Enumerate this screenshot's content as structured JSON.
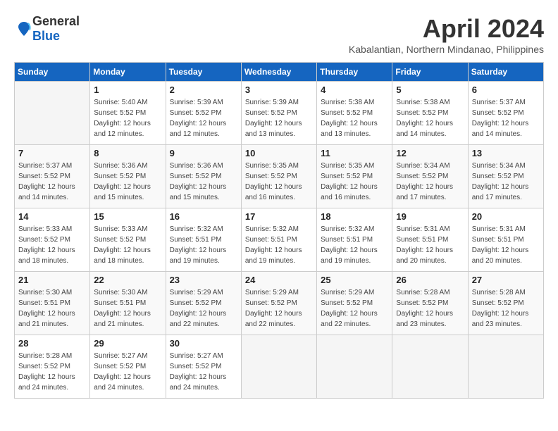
{
  "logo": {
    "general": "General",
    "blue": "Blue"
  },
  "title": "April 2024",
  "location": "Kabalantian, Northern Mindanao, Philippines",
  "weekdays": [
    "Sunday",
    "Monday",
    "Tuesday",
    "Wednesday",
    "Thursday",
    "Friday",
    "Saturday"
  ],
  "weeks": [
    [
      {
        "day": "",
        "sunrise": "",
        "sunset": "",
        "daylight": ""
      },
      {
        "day": "1",
        "sunrise": "Sunrise: 5:40 AM",
        "sunset": "Sunset: 5:52 PM",
        "daylight": "Daylight: 12 hours and 12 minutes."
      },
      {
        "day": "2",
        "sunrise": "Sunrise: 5:39 AM",
        "sunset": "Sunset: 5:52 PM",
        "daylight": "Daylight: 12 hours and 12 minutes."
      },
      {
        "day": "3",
        "sunrise": "Sunrise: 5:39 AM",
        "sunset": "Sunset: 5:52 PM",
        "daylight": "Daylight: 12 hours and 13 minutes."
      },
      {
        "day": "4",
        "sunrise": "Sunrise: 5:38 AM",
        "sunset": "Sunset: 5:52 PM",
        "daylight": "Daylight: 12 hours and 13 minutes."
      },
      {
        "day": "5",
        "sunrise": "Sunrise: 5:38 AM",
        "sunset": "Sunset: 5:52 PM",
        "daylight": "Daylight: 12 hours and 14 minutes."
      },
      {
        "day": "6",
        "sunrise": "Sunrise: 5:37 AM",
        "sunset": "Sunset: 5:52 PM",
        "daylight": "Daylight: 12 hours and 14 minutes."
      }
    ],
    [
      {
        "day": "7",
        "sunrise": "Sunrise: 5:37 AM",
        "sunset": "Sunset: 5:52 PM",
        "daylight": "Daylight: 12 hours and 14 minutes."
      },
      {
        "day": "8",
        "sunrise": "Sunrise: 5:36 AM",
        "sunset": "Sunset: 5:52 PM",
        "daylight": "Daylight: 12 hours and 15 minutes."
      },
      {
        "day": "9",
        "sunrise": "Sunrise: 5:36 AM",
        "sunset": "Sunset: 5:52 PM",
        "daylight": "Daylight: 12 hours and 15 minutes."
      },
      {
        "day": "10",
        "sunrise": "Sunrise: 5:35 AM",
        "sunset": "Sunset: 5:52 PM",
        "daylight": "Daylight: 12 hours and 16 minutes."
      },
      {
        "day": "11",
        "sunrise": "Sunrise: 5:35 AM",
        "sunset": "Sunset: 5:52 PM",
        "daylight": "Daylight: 12 hours and 16 minutes."
      },
      {
        "day": "12",
        "sunrise": "Sunrise: 5:34 AM",
        "sunset": "Sunset: 5:52 PM",
        "daylight": "Daylight: 12 hours and 17 minutes."
      },
      {
        "day": "13",
        "sunrise": "Sunrise: 5:34 AM",
        "sunset": "Sunset: 5:52 PM",
        "daylight": "Daylight: 12 hours and 17 minutes."
      }
    ],
    [
      {
        "day": "14",
        "sunrise": "Sunrise: 5:33 AM",
        "sunset": "Sunset: 5:52 PM",
        "daylight": "Daylight: 12 hours and 18 minutes."
      },
      {
        "day": "15",
        "sunrise": "Sunrise: 5:33 AM",
        "sunset": "Sunset: 5:52 PM",
        "daylight": "Daylight: 12 hours and 18 minutes."
      },
      {
        "day": "16",
        "sunrise": "Sunrise: 5:32 AM",
        "sunset": "Sunset: 5:51 PM",
        "daylight": "Daylight: 12 hours and 19 minutes."
      },
      {
        "day": "17",
        "sunrise": "Sunrise: 5:32 AM",
        "sunset": "Sunset: 5:51 PM",
        "daylight": "Daylight: 12 hours and 19 minutes."
      },
      {
        "day": "18",
        "sunrise": "Sunrise: 5:32 AM",
        "sunset": "Sunset: 5:51 PM",
        "daylight": "Daylight: 12 hours and 19 minutes."
      },
      {
        "day": "19",
        "sunrise": "Sunrise: 5:31 AM",
        "sunset": "Sunset: 5:51 PM",
        "daylight": "Daylight: 12 hours and 20 minutes."
      },
      {
        "day": "20",
        "sunrise": "Sunrise: 5:31 AM",
        "sunset": "Sunset: 5:51 PM",
        "daylight": "Daylight: 12 hours and 20 minutes."
      }
    ],
    [
      {
        "day": "21",
        "sunrise": "Sunrise: 5:30 AM",
        "sunset": "Sunset: 5:51 PM",
        "daylight": "Daylight: 12 hours and 21 minutes."
      },
      {
        "day": "22",
        "sunrise": "Sunrise: 5:30 AM",
        "sunset": "Sunset: 5:51 PM",
        "daylight": "Daylight: 12 hours and 21 minutes."
      },
      {
        "day": "23",
        "sunrise": "Sunrise: 5:29 AM",
        "sunset": "Sunset: 5:52 PM",
        "daylight": "Daylight: 12 hours and 22 minutes."
      },
      {
        "day": "24",
        "sunrise": "Sunrise: 5:29 AM",
        "sunset": "Sunset: 5:52 PM",
        "daylight": "Daylight: 12 hours and 22 minutes."
      },
      {
        "day": "25",
        "sunrise": "Sunrise: 5:29 AM",
        "sunset": "Sunset: 5:52 PM",
        "daylight": "Daylight: 12 hours and 22 minutes."
      },
      {
        "day": "26",
        "sunrise": "Sunrise: 5:28 AM",
        "sunset": "Sunset: 5:52 PM",
        "daylight": "Daylight: 12 hours and 23 minutes."
      },
      {
        "day": "27",
        "sunrise": "Sunrise: 5:28 AM",
        "sunset": "Sunset: 5:52 PM",
        "daylight": "Daylight: 12 hours and 23 minutes."
      }
    ],
    [
      {
        "day": "28",
        "sunrise": "Sunrise: 5:28 AM",
        "sunset": "Sunset: 5:52 PM",
        "daylight": "Daylight: 12 hours and 24 minutes."
      },
      {
        "day": "29",
        "sunrise": "Sunrise: 5:27 AM",
        "sunset": "Sunset: 5:52 PM",
        "daylight": "Daylight: 12 hours and 24 minutes."
      },
      {
        "day": "30",
        "sunrise": "Sunrise: 5:27 AM",
        "sunset": "Sunset: 5:52 PM",
        "daylight": "Daylight: 12 hours and 24 minutes."
      },
      {
        "day": "",
        "sunrise": "",
        "sunset": "",
        "daylight": ""
      },
      {
        "day": "",
        "sunrise": "",
        "sunset": "",
        "daylight": ""
      },
      {
        "day": "",
        "sunrise": "",
        "sunset": "",
        "daylight": ""
      },
      {
        "day": "",
        "sunrise": "",
        "sunset": "",
        "daylight": ""
      }
    ]
  ]
}
